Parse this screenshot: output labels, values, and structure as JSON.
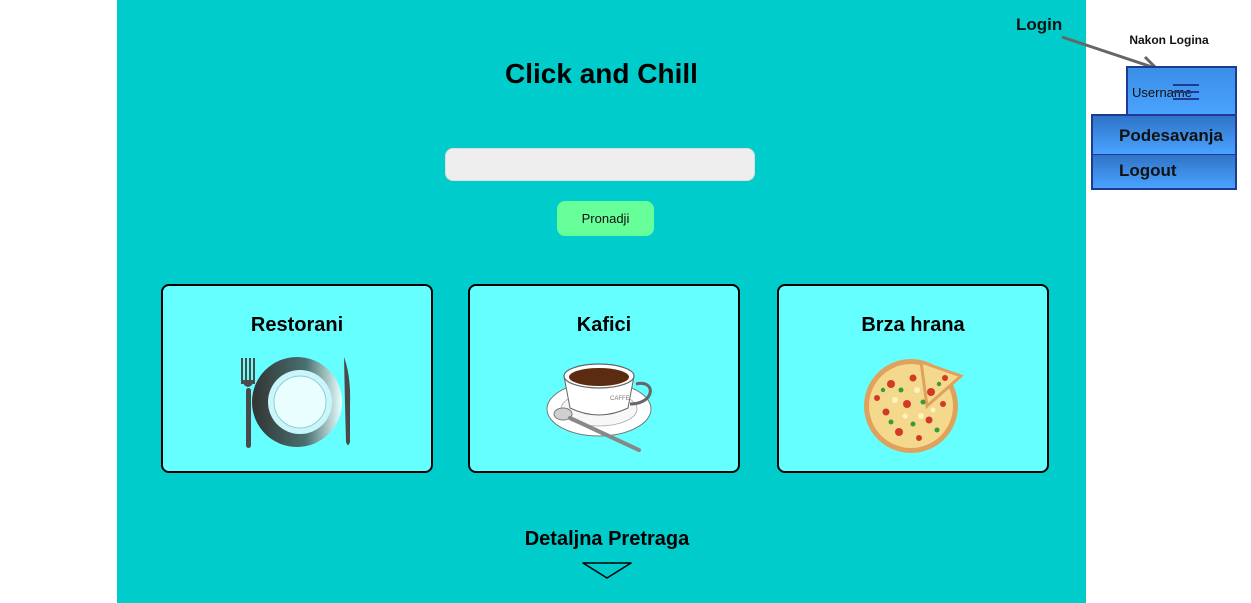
{
  "app": {
    "title": "Click and Chill"
  },
  "search": {
    "placeholder": "",
    "button_label": "Pronadji"
  },
  "categories": [
    {
      "label": "Restorani",
      "icon": "plate-fork-knife-icon"
    },
    {
      "label": "Kafici",
      "icon": "coffee-cup-icon",
      "cup_text": "CAFFE"
    },
    {
      "label": "Brza hrana",
      "icon": "pizza-icon"
    }
  ],
  "detail_search": {
    "label": "Detaljna Pretraga",
    "icon": "chevron-down-icon"
  },
  "header": {
    "login_label": "Login"
  },
  "annotation": {
    "label": "Nakon Logina"
  },
  "user_menu": {
    "username": "Username",
    "items": [
      {
        "label": "Podesavanja"
      },
      {
        "label": "Logout"
      }
    ]
  },
  "colors": {
    "background": "#00cccc",
    "card": "#66ffff",
    "button": "#66ff99",
    "menu": "#4aa3ff",
    "menu_border": "#1f3a93"
  }
}
